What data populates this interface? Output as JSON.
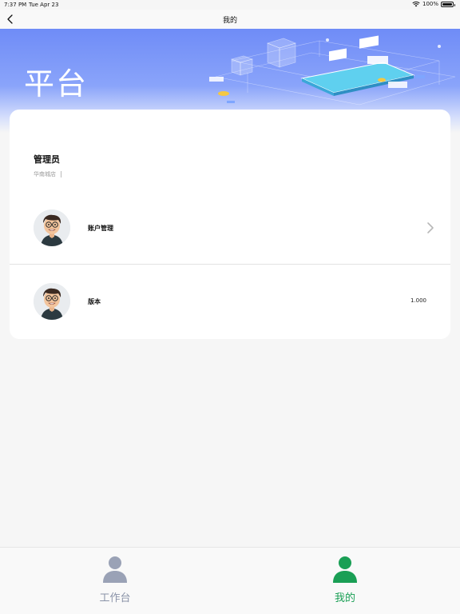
{
  "status": {
    "time": "7:37 PM",
    "date": "Tue Apr 23",
    "battery": "100%"
  },
  "nav": {
    "title": "我的"
  },
  "hero": {
    "title": "平台"
  },
  "profile": {
    "name": "管理员",
    "store": "华南城店"
  },
  "menu": {
    "account_label": "账户管理",
    "version_label": "版本",
    "version_value": "1.000"
  },
  "tabs": [
    {
      "label": "工作台",
      "active": false
    },
    {
      "label": "我的",
      "active": true
    }
  ],
  "colors": {
    "active_tab": "#1a9f55",
    "inactive_tab": "#8a93a8",
    "hero": "#6f8cf7"
  }
}
